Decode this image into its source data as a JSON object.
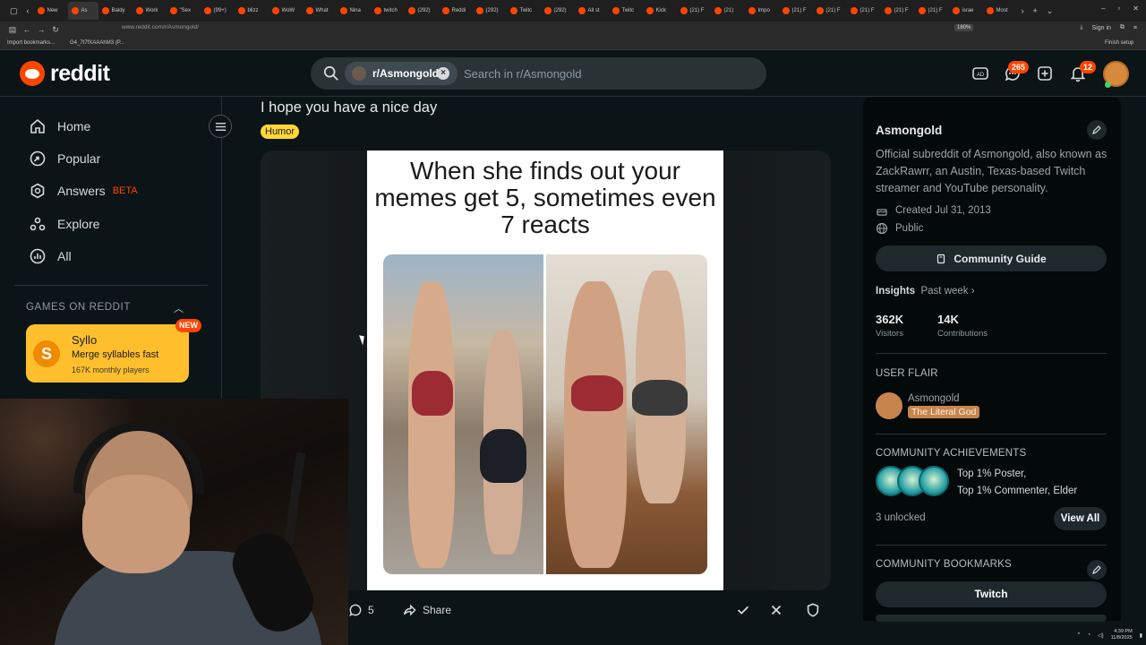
{
  "browser": {
    "tabs": [
      "New",
      "As",
      "Baldy",
      "Work",
      "\"Sex",
      "(99+)",
      "blizz",
      "WoW",
      "What",
      "Nina",
      "twitch",
      "(292)",
      "Reddi",
      "(292)",
      "Twitc",
      "(292)",
      "All st",
      "Twitc",
      "Kick",
      "(21) F",
      "(21) ",
      "Impo",
      "(21) F",
      "(21) F",
      "(21) F",
      "(21) F",
      "(21) F",
      "israe",
      "Most"
    ],
    "url": "www.reddit.com/r/Asmongold/",
    "zoom": "180%",
    "sign_in": "Sign in",
    "bookmarks": [
      "Import bookmarks...",
      "G4_7t7fXAAAhM3 (P...",
      "Finish setup"
    ]
  },
  "header": {
    "logo_text": "reddit",
    "search_chip": "r/Asmongold",
    "search_placeholder": "Search in r/Asmongold",
    "chat_badge": "265",
    "notif_badge": "12"
  },
  "left_nav": {
    "items": [
      {
        "label": "Home",
        "icon": "home-icon"
      },
      {
        "label": "Popular",
        "icon": "popular-icon"
      },
      {
        "label": "Answers",
        "icon": "answers-icon",
        "tag": "BETA"
      },
      {
        "label": "Explore",
        "icon": "explore-icon"
      },
      {
        "label": "All",
        "icon": "all-icon"
      }
    ],
    "games_header": "GAMES ON REDDIT",
    "game": {
      "icon_letter": "S",
      "title": "Syllo",
      "subtitle": "Merge syllables fast",
      "players": "167K monthly players",
      "badge": "NEW"
    }
  },
  "post": {
    "title": "I hope you have a nice day",
    "flair": "Humor",
    "meme_caption": "When she finds out your memes get 5, sometimes even 7 reacts",
    "comments": "5",
    "share": "Share"
  },
  "community": {
    "name": "Asmongold",
    "description": "Official subreddit of Asmongold, also known as ZackRawrr, an Austin, Texas-based Twitch streamer and YouTube personality.",
    "created": "Created Jul 31, 2013",
    "visibility": "Public",
    "guide_button": "Community Guide",
    "insights_label": "Insights",
    "insights_range": "Past week",
    "visitors_value": "362K",
    "visitors_label": "Visitors",
    "contrib_value": "14K",
    "contrib_label": "Contributions",
    "user_flair_header": "USER FLAIR",
    "user_name": "Asmongold",
    "user_flair": "The Literal God",
    "achievements_header": "COMMUNITY ACHIEVEMENTS",
    "achievement_1": "Top 1% Poster,",
    "achievement_2": "Top 1% Commenter, Elder",
    "unlocked": "3 unlocked",
    "view_all": "View All",
    "bookmarks_header": "COMMUNITY BOOKMARKS",
    "bookmark_1": "Twitch"
  },
  "tray": {
    "time": "4:39 PM",
    "date": "11/8/2025"
  },
  "colors": {
    "reddit_orange": "#ff4500",
    "background": "#0b1416",
    "flair_yellow": "#ffd635",
    "game_card": "#ffbf2d"
  }
}
